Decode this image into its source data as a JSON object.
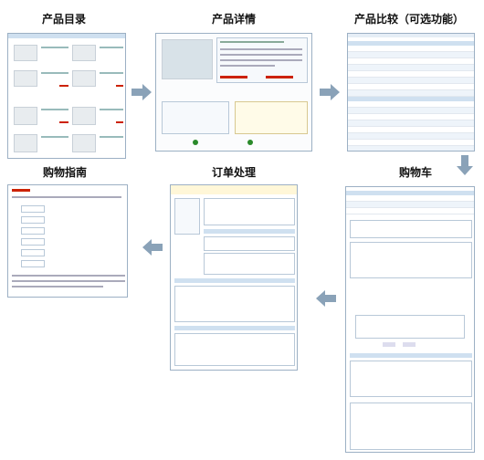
{
  "steps": {
    "catalog": "产品目录",
    "detail": "产品详情",
    "compare": "产品比较（可选功能）",
    "guide": "购物指南",
    "order": "订单处理",
    "cart": "购物车"
  },
  "colors": {
    "arrow": "#8aa2b8",
    "panel_border": "#9cb0c4",
    "header_blue": "#cfe0f0",
    "link_red": "#cc2200"
  }
}
